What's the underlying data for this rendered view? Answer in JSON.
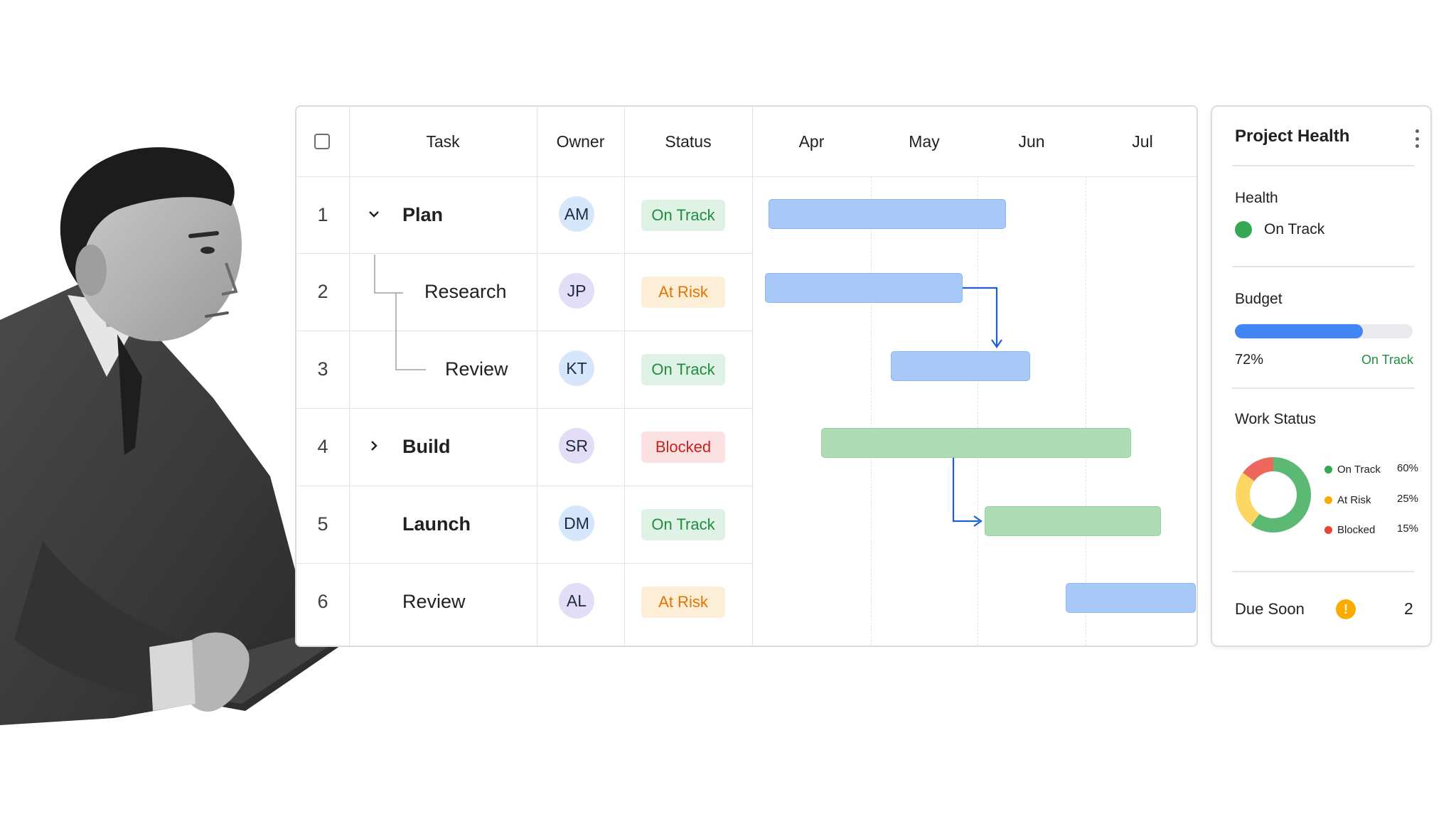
{
  "table": {
    "headers": {
      "task": "Task",
      "owner": "Owner",
      "status": "Status"
    },
    "rows": [
      {
        "num": "1",
        "task": "Plan",
        "owner": "AM",
        "status": "On Track",
        "status_kind": "ontrack",
        "expander": "chevron-down"
      },
      {
        "num": "2",
        "task": "Research",
        "owner": "JP",
        "status": "At Risk",
        "status_kind": "atrisk"
      },
      {
        "num": "3",
        "task": "Review",
        "owner": "KT",
        "status": "On Track",
        "status_kind": "ontrack"
      },
      {
        "num": "4",
        "task": "Build",
        "owner": "SR",
        "status": "Blocked",
        "status_kind": "blocked",
        "expander": "chevron-right"
      },
      {
        "num": "5",
        "task": "Launch",
        "owner": "DM",
        "status": "On Track",
        "status_kind": "ontrack"
      },
      {
        "num": "6",
        "task": "Review",
        "owner": "AL",
        "status": "At Risk",
        "status_kind": "atrisk"
      }
    ]
  },
  "timeline": {
    "months": [
      "Apr",
      "May",
      "Jun",
      "Jul"
    ],
    "bars": [
      {
        "row": 1,
        "color": "blue",
        "start": "early Apr",
        "end": "mid Jun"
      },
      {
        "row": 2,
        "color": "blue",
        "start": "early Apr",
        "end": "early Jun"
      },
      {
        "row": 3,
        "color": "blue",
        "start": "mid May",
        "end": "late Jun"
      },
      {
        "row": 4,
        "color": "green",
        "start": "mid Apr",
        "end": "mid Jul"
      },
      {
        "row": 5,
        "color": "green",
        "start": "early Jun",
        "end": "late Jul"
      },
      {
        "row": 6,
        "color": "blue",
        "start": "late Jun",
        "end": "end Jul"
      }
    ],
    "dependencies": [
      {
        "from_row": 2,
        "to_row": 3
      },
      {
        "from_row": 4,
        "to_row": 5
      }
    ]
  },
  "health": {
    "title": "Project Health",
    "health_label": "Health",
    "health_status": "On Track",
    "budget_label": "Budget",
    "budget_percent": "72%",
    "budget_fraction": 0.72,
    "budget_status": "On Track",
    "work_status_label": "Work Status",
    "work_status": [
      {
        "name": "On Track",
        "pct": "60%",
        "value": 60,
        "color": "#5bb974"
      },
      {
        "name": "At Risk",
        "pct": "25%",
        "value": 25,
        "color": "#fdd663"
      },
      {
        "name": "Blocked",
        "pct": "15%",
        "value": 15,
        "color": "#ee675c"
      }
    ],
    "due_soon_label": "Due Soon",
    "due_soon_count": "2",
    "warn_glyph": "!"
  },
  "colors": {
    "on_track": "#1e8e3e",
    "at_risk": "#e37400",
    "blocked": "#c5221f",
    "bar_blue": "#a8c9f7",
    "bar_green": "#aedcb4",
    "arrow": "#1a5fd6",
    "health_dot": "#34a853"
  }
}
